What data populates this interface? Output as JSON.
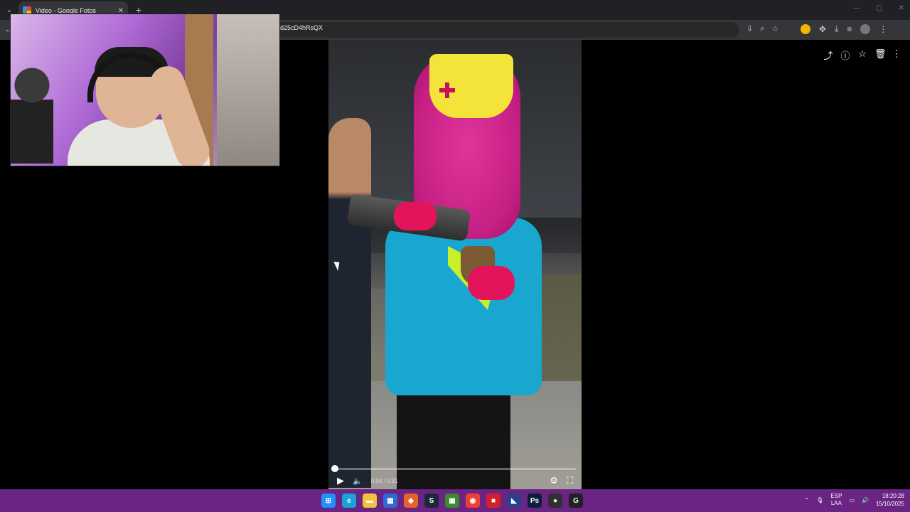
{
  "browser": {
    "tab": {
      "title": "Video - Google Fotos",
      "close_label": "✕"
    },
    "new_tab_label": "+",
    "tab_list_label": "⌄",
    "window_controls": [
      "—",
      "▢",
      "✕"
    ],
    "url": "d25cD4hRsQX",
    "back_label": "←"
  },
  "viewer": {
    "actions": [
      {
        "name": "share-icon",
        "glyph": "⤴"
      },
      {
        "name": "info-icon",
        "glyph": "ⓘ"
      },
      {
        "name": "favorite-star-icon",
        "glyph": "☆"
      },
      {
        "name": "trash-icon",
        "glyph": "🗑"
      },
      {
        "name": "more-options-icon",
        "glyph": "⋮"
      }
    ]
  },
  "video": {
    "time": "0:00 / 0:31",
    "progress": 0
  },
  "taskbar": {
    "apps": [
      {
        "name": "windows-start-icon",
        "color": "#1e90ff",
        "glyph": "⊞"
      },
      {
        "name": "edge-icon",
        "color": "#1ba3d9",
        "glyph": "e"
      },
      {
        "name": "file-explorer-icon",
        "color": "#f2c23b",
        "glyph": "▬"
      },
      {
        "name": "store-icon",
        "color": "#2e6bd6",
        "glyph": "▦"
      },
      {
        "name": "app-orange-icon",
        "color": "#e6612b",
        "glyph": "◆"
      },
      {
        "name": "steam-icon",
        "color": "#1b2838",
        "glyph": "S"
      },
      {
        "name": "minecraft-icon",
        "color": "#3c8a2e",
        "glyph": "▣"
      },
      {
        "name": "chrome-icon",
        "color": "#e94235",
        "glyph": "◉"
      },
      {
        "name": "app-red-icon",
        "color": "#d61f2b",
        "glyph": "■"
      },
      {
        "name": "app-blue-icon",
        "color": "#2b3f8a",
        "glyph": "◣"
      },
      {
        "name": "photoshop-icon",
        "color": "#0b1f3b",
        "glyph": "Ps"
      },
      {
        "name": "obs-icon",
        "color": "#303030",
        "glyph": "●"
      },
      {
        "name": "app-g-icon",
        "color": "#222222",
        "glyph": "G"
      }
    ],
    "language_top": "ESP",
    "language_bottom": "LAA",
    "time": "18:20:28",
    "date": "15/10/2025"
  }
}
